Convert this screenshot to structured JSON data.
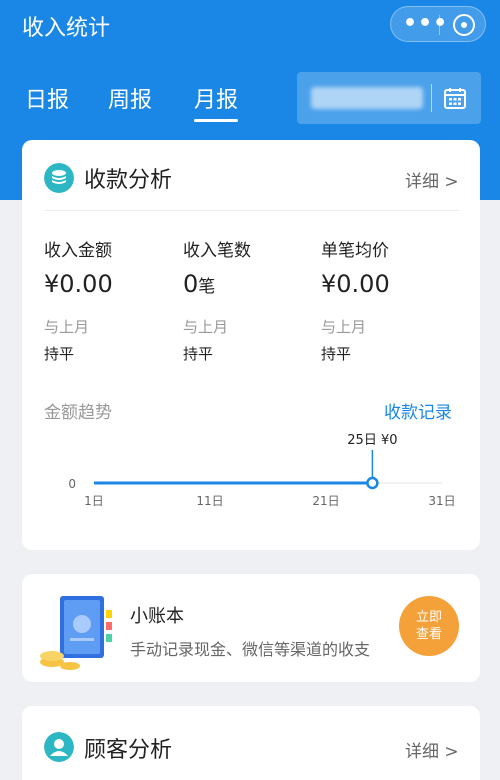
{
  "app": {
    "title": "收入统计"
  },
  "tabs": [
    {
      "label": "日报"
    },
    {
      "label": "周报"
    },
    {
      "label": "月报"
    }
  ],
  "active_tab": "月报",
  "colors": {
    "brand": "#1a87e6",
    "accent_orange": "#f5a13a",
    "icon_teal": "#2db7c4"
  },
  "payment_analysis": {
    "title": "收款分析",
    "detail": "详细 >",
    "stats": [
      {
        "label": "收入金额",
        "value": "¥0.00",
        "unit": "",
        "compare": "与上月",
        "status": "持平"
      },
      {
        "label": "收入笔数",
        "value": "0",
        "unit": "笔",
        "compare": "与上月",
        "status": "持平"
      },
      {
        "label": "单笔均价",
        "value": "¥0.00",
        "unit": "",
        "compare": "与上月",
        "status": "持平"
      }
    ],
    "trend_title": "金额趋势",
    "record_link": "收款记录"
  },
  "chart_data": {
    "type": "line",
    "x_ticks": [
      "1日",
      "11日",
      "21日",
      "31日"
    ],
    "y_ticks": [
      "0"
    ],
    "x": [
      1,
      25
    ],
    "values": [
      0,
      0
    ],
    "xlim": [
      1,
      31
    ],
    "highlight": {
      "x": 25,
      "label": "25日 ¥0"
    }
  },
  "ledger": {
    "title": "小账本",
    "description": "手动记录现金、微信等渠道的收支",
    "button_line1": "立即",
    "button_line2": "查看"
  },
  "customer_analysis": {
    "title": "顾客分析",
    "detail": "详细 >"
  },
  "icons": [
    "more-icon",
    "close-mini-program-icon",
    "calendar-icon",
    "coins-icon",
    "ledger-book-icon",
    "user-icon"
  ]
}
